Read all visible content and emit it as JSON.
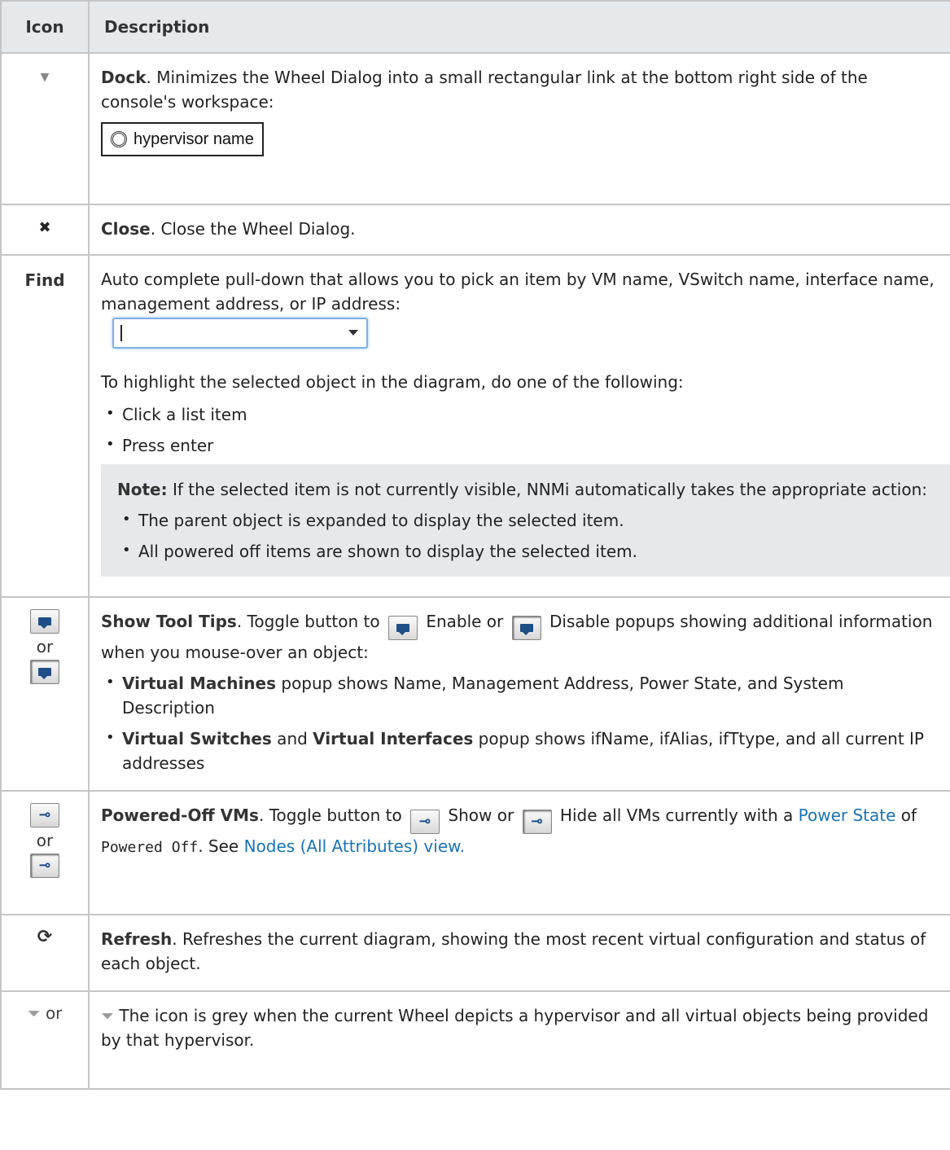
{
  "header": {
    "icon": "Icon",
    "description": "Description"
  },
  "rows": {
    "dock": {
      "icon": "triangle-down-icon",
      "title": "Dock",
      "text": ". Minimizes the Wheel Dialog into a small rectangular link at the bottom right side of the console's workspace:",
      "sample": "hypervisor name"
    },
    "close": {
      "icon": "close-x-icon",
      "title": "Close",
      "text": ". Close the Wheel Dialog."
    },
    "find": {
      "label": "Find",
      "text": "Auto complete pull-down that allows you to pick an item by VM name, VSwitch name, interface name, management address, or IP address:",
      "intro": "To highlight the selected object in the diagram, do one of the following:",
      "bullets": [
        "Click a list item",
        "Press enter"
      ],
      "note_label": "Note:",
      "note_text": " If the selected item is not currently visible, NNMi automatically takes the appropriate action:",
      "note_bullets": [
        "The parent object is expanded to display the selected item.",
        "All powered off items are shown to display the selected item."
      ]
    },
    "tooltips": {
      "or": "or",
      "title": "Show Tool Tips",
      "t1": ". Toggle button to ",
      "t2": " Enable or ",
      "t3": " Disable popups showing additional information when you mouse-over an object:",
      "b1_bold": "Virtual Machines",
      "b1_text": " popup shows Name, Management Address, Power State, and System Description",
      "b2_bold1": "Virtual Switches",
      "b2_and": " and ",
      "b2_bold2": "Virtual Interfaces",
      "b2_text": " popup shows ifName, ifAlias, ifTtype, and all current IP addresses"
    },
    "powered": {
      "or": "or",
      "title": "Powered-Off VMs",
      "t1": ". Toggle button to ",
      "t2": " Show or ",
      "t3": " Hide all VMs currently with a ",
      "link1": "Power State",
      "t4": " of ",
      "code": "Powered Off",
      "t5": ". See ",
      "link2": "Nodes (All Attributes) view."
    },
    "refresh": {
      "icon": "refresh-icon",
      "title": "Refresh",
      "text": ". Refreshes the current diagram, showing the most recent virtual configuration and status of each object."
    },
    "filter": {
      "icon_label": "or",
      "text": " The icon is grey when the current Wheel depicts a hypervisor and all virtual objects being provided by that hypervisor."
    }
  },
  "colors": {
    "link": "#1a73b5",
    "header_bg": "#e6e9eb",
    "note_bg": "#e5e9eb",
    "border": "#c6c6c6"
  }
}
